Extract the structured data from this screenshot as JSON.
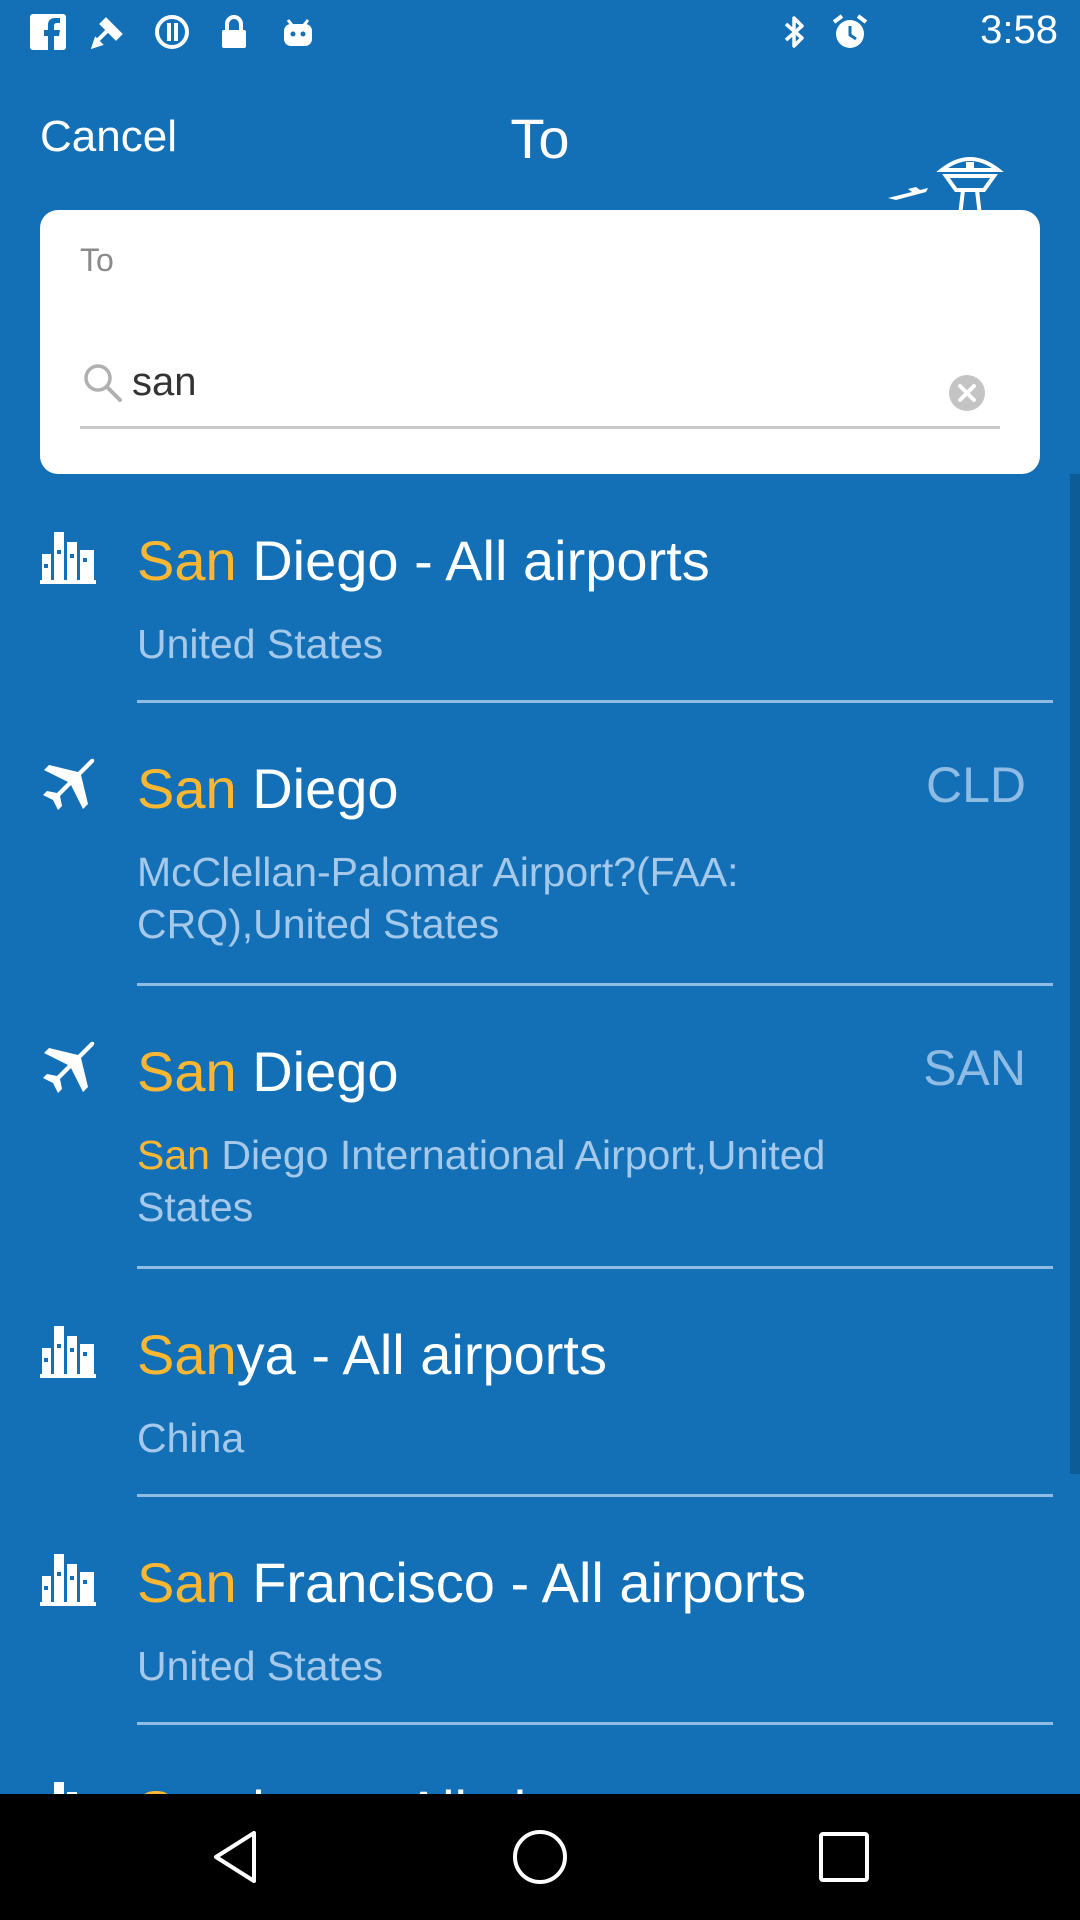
{
  "status_bar": {
    "time": "3:58",
    "icons": [
      "facebook-icon",
      "no-sim-satellite-icon",
      "sync-icon",
      "lock-icon",
      "android-icon",
      "bluetooth-icon",
      "alarm-icon"
    ]
  },
  "header": {
    "cancel_label": "Cancel",
    "title": "To"
  },
  "search": {
    "label": "To",
    "value": "san"
  },
  "results": [
    {
      "icon": "city-icon",
      "highlight": "San",
      "rest": " Diego - All airports",
      "code": "",
      "sub_highlight": "",
      "sub_rest": "United States"
    },
    {
      "icon": "airplane-icon",
      "highlight": "San",
      "rest": " Diego",
      "code": "CLD",
      "sub_highlight": "",
      "sub_rest": "McClellan-Palomar Airport?(FAA: CRQ),United States"
    },
    {
      "icon": "airplane-icon",
      "highlight": "San",
      "rest": " Diego",
      "code": "SAN",
      "sub_highlight": "San",
      "sub_rest": " Diego International Airport,United States"
    },
    {
      "icon": "city-icon",
      "highlight": "San",
      "rest": "ya - All airports",
      "code": "",
      "sub_highlight": "",
      "sub_rest": "China"
    },
    {
      "icon": "city-icon",
      "highlight": "San",
      "rest": " Francisco - All airports",
      "code": "",
      "sub_highlight": "",
      "sub_rest": "United States"
    },
    {
      "icon": "city-icon",
      "highlight": "San",
      "rest": "tiago - All airports",
      "code": "",
      "sub_highlight": "",
      "sub_rest": ""
    }
  ],
  "colors": {
    "background": "#1370b7",
    "highlight": "#fbb731",
    "secondary_text": "#a6c9ea",
    "code_text": "#8fbce4"
  },
  "nav_bar": {
    "buttons": [
      "back-icon",
      "home-icon",
      "recents-icon"
    ]
  }
}
